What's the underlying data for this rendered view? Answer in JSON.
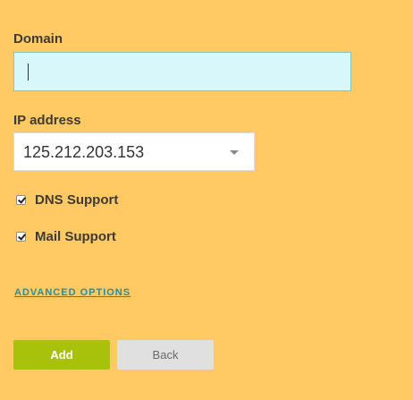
{
  "form": {
    "domain_label": "Domain",
    "domain_value": "",
    "ip_label": "IP address",
    "ip_selected": "125.212.203.153",
    "dns_support_label": "DNS Support",
    "dns_support_checked": true,
    "mail_support_label": "Mail Support",
    "mail_support_checked": true,
    "advanced_options_label": "ADVANCED OPTIONS"
  },
  "buttons": {
    "add_label": "Add",
    "back_label": "Back"
  },
  "colors": {
    "background": "#ffca64",
    "input_bg": "#d8f7fb",
    "add_button": "#a8c20c",
    "back_button": "#e0e0e0",
    "link": "#2e8c96"
  }
}
